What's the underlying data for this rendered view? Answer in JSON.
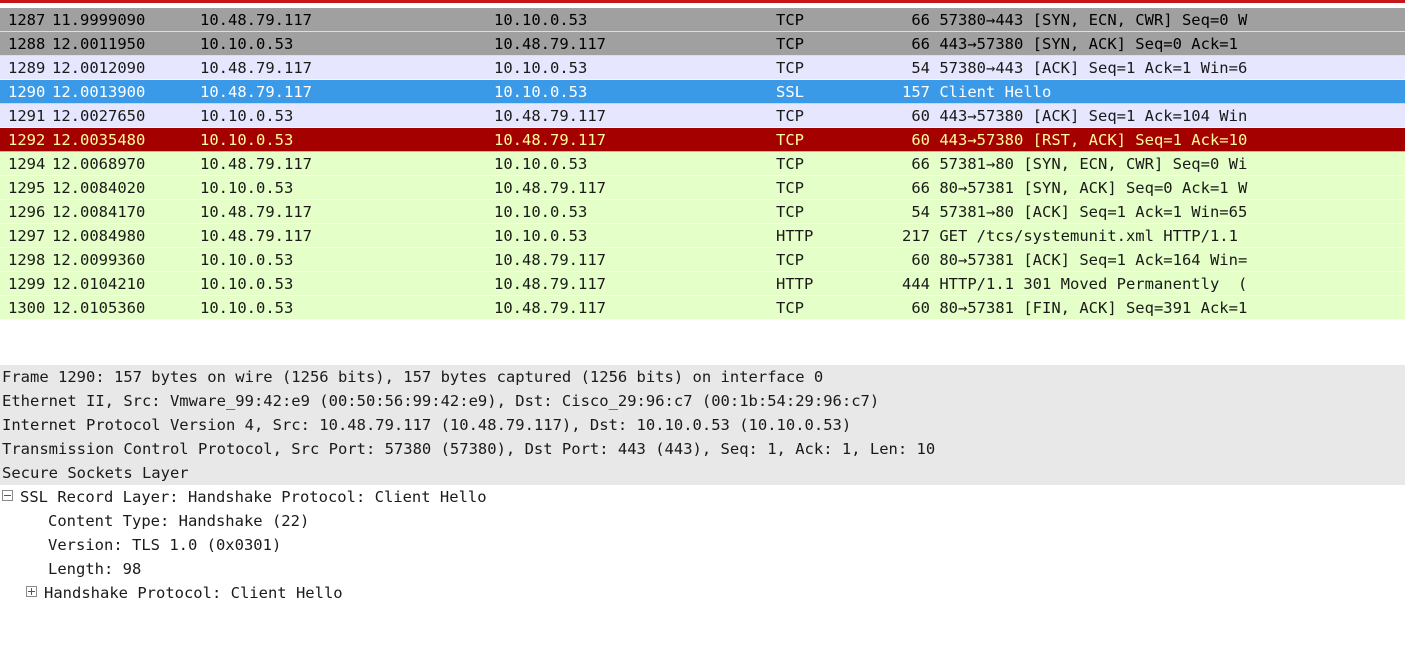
{
  "packets": [
    {
      "no": "1287",
      "time": "11.9999090",
      "src": "10.48.79.117",
      "dst": "10.10.0.53",
      "proto": "TCP",
      "len": "66",
      "info": "57380→443 [SYN, ECN, CWR] Seq=0 W",
      "style": "gray"
    },
    {
      "no": "1288",
      "time": "12.0011950",
      "src": "10.10.0.53",
      "dst": "10.48.79.117",
      "proto": "TCP",
      "len": "66",
      "info": "443→57380 [SYN, ACK] Seq=0 Ack=1",
      "style": "gray"
    },
    {
      "no": "1289",
      "time": "12.0012090",
      "src": "10.48.79.117",
      "dst": "10.10.0.53",
      "proto": "TCP",
      "len": "54",
      "info": "57380→443 [ACK] Seq=1 Ack=1 Win=6",
      "style": "lav"
    },
    {
      "no": "1290",
      "time": "12.0013900",
      "src": "10.48.79.117",
      "dst": "10.10.0.53",
      "proto": "SSL",
      "len": "157",
      "info": "Client Hello",
      "style": "sel"
    },
    {
      "no": "1291",
      "time": "12.0027650",
      "src": "10.10.0.53",
      "dst": "10.48.79.117",
      "proto": "TCP",
      "len": "60",
      "info": "443→57380 [ACK] Seq=1 Ack=104 Win",
      "style": "lav"
    },
    {
      "no": "1292",
      "time": "12.0035480",
      "src": "10.10.0.53",
      "dst": "10.48.79.117",
      "proto": "TCP",
      "len": "60",
      "info": "443→57380 [RST, ACK] Seq=1 Ack=10",
      "style": "rst"
    },
    {
      "no": "1294",
      "time": "12.0068970",
      "src": "10.48.79.117",
      "dst": "10.10.0.53",
      "proto": "TCP",
      "len": "66",
      "info": "57381→80 [SYN, ECN, CWR] Seq=0 Wi",
      "style": "green"
    },
    {
      "no": "1295",
      "time": "12.0084020",
      "src": "10.10.0.53",
      "dst": "10.48.79.117",
      "proto": "TCP",
      "len": "66",
      "info": "80→57381 [SYN, ACK] Seq=0 Ack=1 W",
      "style": "green"
    },
    {
      "no": "1296",
      "time": "12.0084170",
      "src": "10.48.79.117",
      "dst": "10.10.0.53",
      "proto": "TCP",
      "len": "54",
      "info": "57381→80 [ACK] Seq=1 Ack=1 Win=65",
      "style": "green"
    },
    {
      "no": "1297",
      "time": "12.0084980",
      "src": "10.48.79.117",
      "dst": "10.10.0.53",
      "proto": "HTTP",
      "len": "217",
      "info": "GET /tcs/systemunit.xml HTTP/1.1",
      "style": "green"
    },
    {
      "no": "1298",
      "time": "12.0099360",
      "src": "10.10.0.53",
      "dst": "10.48.79.117",
      "proto": "TCP",
      "len": "60",
      "info": "80→57381 [ACK] Seq=1 Ack=164 Win=",
      "style": "green"
    },
    {
      "no": "1299",
      "time": "12.0104210",
      "src": "10.10.0.53",
      "dst": "10.48.79.117",
      "proto": "HTTP",
      "len": "444",
      "info": "HTTP/1.1 301 Moved Permanently  (",
      "style": "green"
    },
    {
      "no": "1300",
      "time": "12.0105360",
      "src": "10.10.0.53",
      "dst": "10.48.79.117",
      "proto": "TCP",
      "len": "60",
      "info": "80→57381 [FIN, ACK] Seq=391 Ack=1",
      "style": "green"
    }
  ],
  "details": {
    "frame": "Frame 1290: 157 bytes on wire (1256 bits), 157 bytes captured (1256 bits) on interface 0",
    "ethernet": "Ethernet II, Src: Vmware_99:42:e9 (00:50:56:99:42:e9), Dst: Cisco_29:96:c7 (00:1b:54:29:96:c7)",
    "ip": "Internet Protocol Version 4, Src: 10.48.79.117 (10.48.79.117), Dst: 10.10.0.53 (10.10.0.53)",
    "tcp": "Transmission Control Protocol, Src Port: 57380 (57380), Dst Port: 443 (443), Seq: 1, Ack: 1, Len: 10",
    "ssl": "Secure Sockets Layer",
    "ssl_record": "SSL Record Layer: Handshake Protocol: Client Hello",
    "content_type": "Content Type: Handshake (22)",
    "version": "Version: TLS 1.0 (0x0301)",
    "length": "Length: 98",
    "handshake": "Handshake Protocol: Client Hello"
  },
  "colors": {
    "gray_row": "#a0a0a0",
    "lavender_row": "#e7e6ff",
    "selected_row": "#3a9ae8",
    "rst_row": "#a40000",
    "rst_text": "#fffc9c",
    "green_row": "#e4ffc7"
  }
}
